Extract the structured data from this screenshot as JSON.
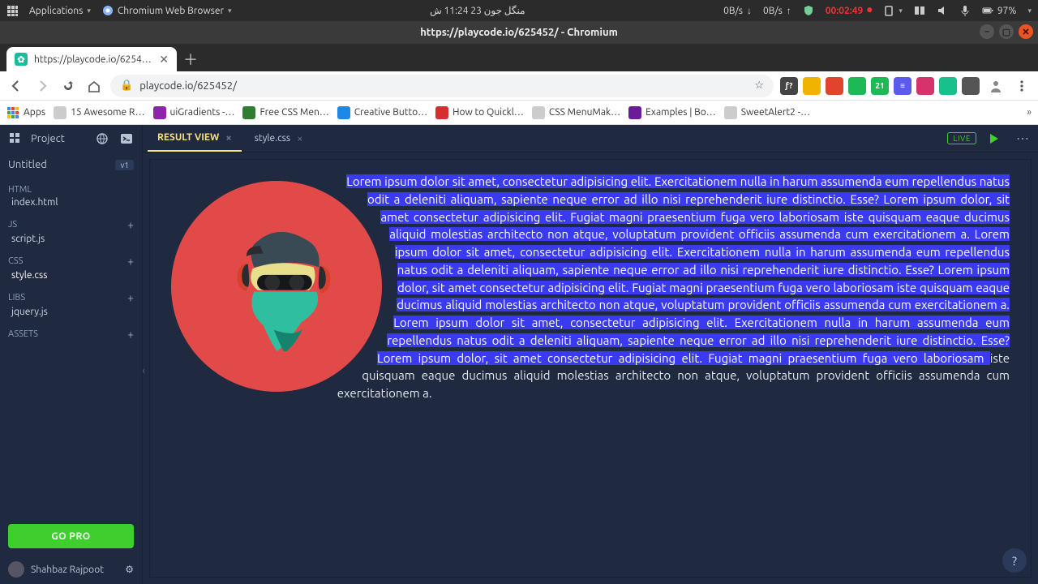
{
  "sys": {
    "apps_label": "Applications",
    "browser_label": "Chromium Web Browser",
    "clock": "منگل جون 23  11:24 ش",
    "down_rate": "0B/s",
    "up_rate": "0B/s",
    "timer": "00:02:49",
    "battery": "97%"
  },
  "window": {
    "title": "https://playcode.io/625452/ - Chromium"
  },
  "tab": {
    "title": "https://playcode.io/6254…",
    "favicon_glyph": "✿"
  },
  "toolbar": {
    "url": "playcode.io/625452/"
  },
  "ext": [
    {
      "bg": "#444",
      "txt": "ƒ?"
    },
    {
      "bg": "#f0b400",
      "txt": ""
    },
    {
      "bg": "#e0452c",
      "txt": ""
    },
    {
      "bg": "#1db954",
      "txt": ""
    },
    {
      "bg": "#1db954",
      "txt": "21"
    },
    {
      "bg": "#5a5aee",
      "txt": "≡"
    },
    {
      "bg": "#d6336c",
      "txt": ""
    },
    {
      "bg": "#18c18c",
      "txt": ""
    },
    {
      "bg": "#555",
      "txt": ""
    }
  ],
  "bookmarks": [
    {
      "label": "Apps",
      "bg": "#4285f4"
    },
    {
      "label": "15 Awesome R…",
      "bg": "#ccc"
    },
    {
      "label": "uiGradients -…",
      "bg": "#8e24aa"
    },
    {
      "label": "Free CSS Men…",
      "bg": "#2e7d32"
    },
    {
      "label": "Creative Butto…",
      "bg": "#1e88e5"
    },
    {
      "label": "How to Quickl…",
      "bg": "#d32f2f"
    },
    {
      "label": "CSS MenuMak…",
      "bg": "#ccc"
    },
    {
      "label": "Examples | Bo…",
      "bg": "#6a1b9a"
    },
    {
      "label": "SweetAlert2 -…",
      "bg": "#ccc"
    }
  ],
  "pc": {
    "project_label": "Project",
    "untitled": "Untitled",
    "version_chip": "v1",
    "sections": {
      "html": {
        "header": "HTML",
        "file": "index.html"
      },
      "js": {
        "header": "JS",
        "file": "script.js"
      },
      "css": {
        "header": "CSS",
        "file": "style.css"
      },
      "libs": {
        "header": "LIBS",
        "file": "jquery.js"
      },
      "assets": {
        "header": "ASSETS"
      }
    },
    "go_pro": "GO PRO",
    "user": "Shahbaz Rajpoot",
    "tabs": {
      "result": "RESULT VIEW",
      "style": "style.css"
    },
    "live": "LIVE",
    "content": {
      "highlighted": "Lorem ipsum dolor sit amet, consectetur adipisicing elit. Exercitationem nulla in harum assumenda eum repellendus natus odit a deleniti aliquam, sapiente neque error ad illo nisi reprehenderit iure distinctio. Esse? Lorem ipsum dolor, sit amet consectetur adipisicing elit. Fugiat magni praesentium fuga vero laboriosam iste quisquam eaque ducimus aliquid molestias architecto non atque, voluptatum provident officiis assumenda cum exercitationem a. Lorem ipsum dolor sit amet, consectetur adipisicing elit. Exercitationem nulla in harum assumenda eum repellendus natus odit a deleniti aliquam, sapiente neque error ad illo nisi reprehenderit iure distinctio. Esse? Lorem ipsum dolor, sit amet consectetur adipisicing elit. Fugiat magni praesentium fuga vero laboriosam iste quisquam eaque ducimus aliquid molestias architecto non atque, voluptatum provident officiis assumenda cum exercitationem a. Lorem ipsum dolor sit amet, consectetur adipisicing elit. Exercitationem nulla in harum assumenda eum repellendus natus odit a deleniti aliquam, sapiente neque error ad illo nisi reprehenderit iure distinctio. Esse? Lorem ipsum dolor, sit amet consectetur adipisicing elit. Fugiat magni praesentium fuga vero laboriosam ",
      "tail": "iste quisquam eaque ducimus aliquid molestias architecto non atque, voluptatum provident officiis assumenda cum exercitationem a."
    },
    "help": "?"
  }
}
